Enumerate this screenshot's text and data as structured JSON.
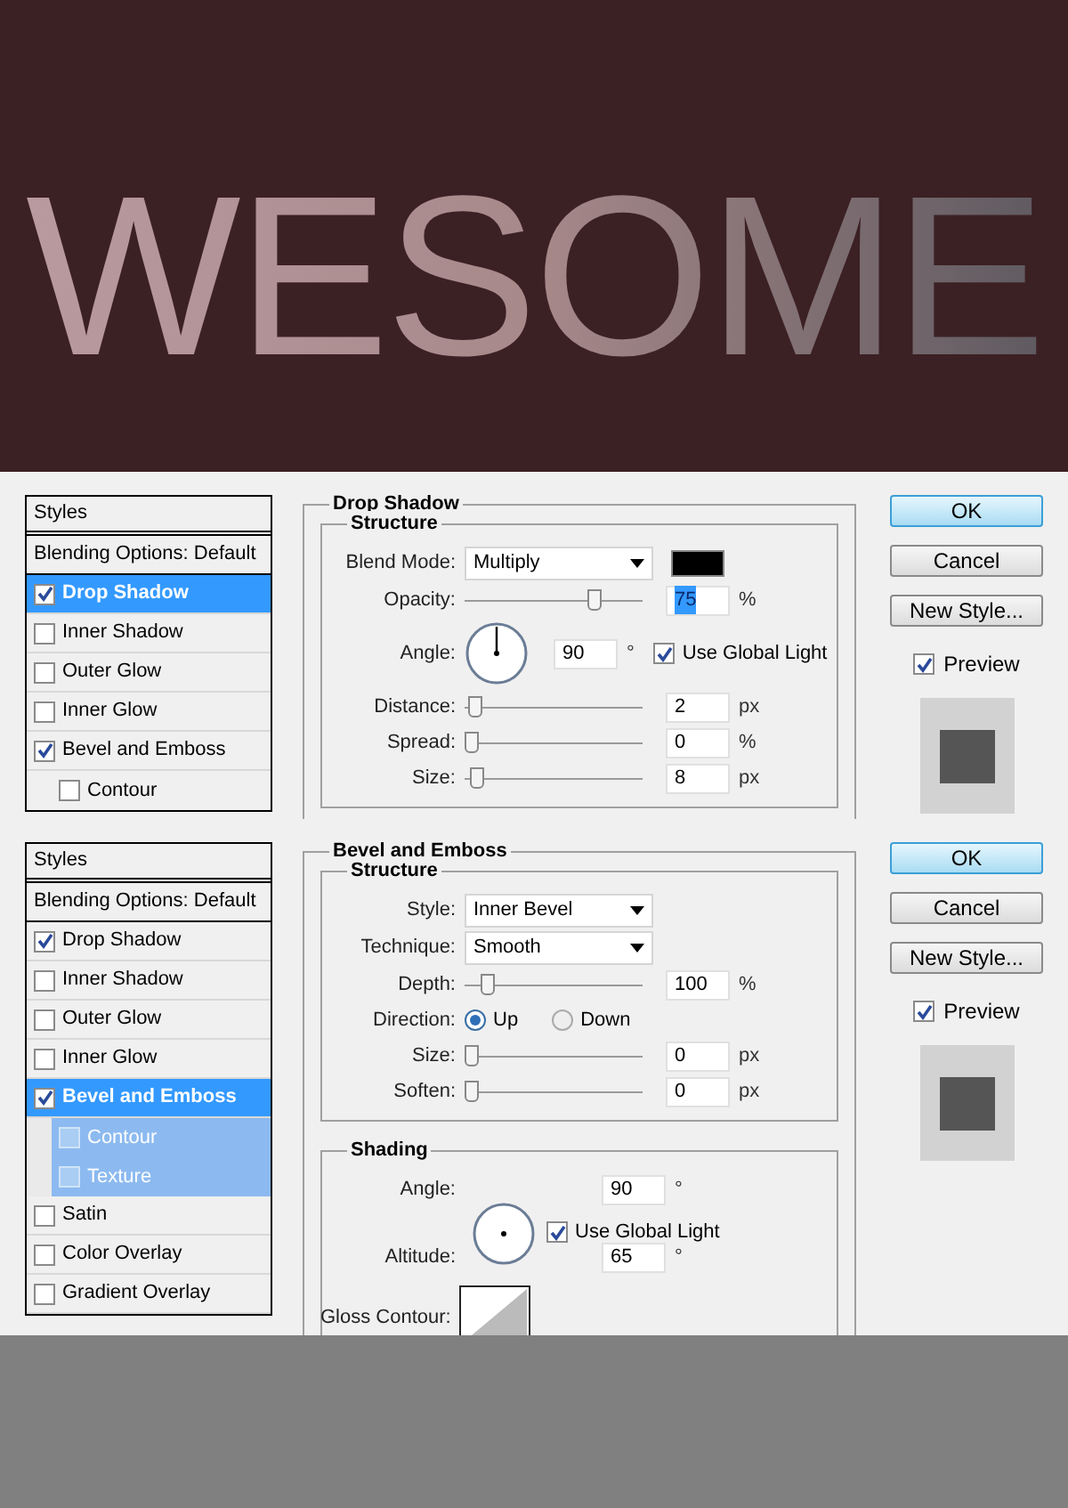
{
  "artwork": {
    "text": "WESOME"
  },
  "dialogs": [
    {
      "styles_header": "Styles",
      "styles": [
        {
          "label": "Blending Options: Default",
          "kind": "header",
          "selected": false
        },
        {
          "label": "Drop Shadow",
          "kind": "effect",
          "checked": true,
          "selected": true
        },
        {
          "label": "Inner Shadow",
          "kind": "effect",
          "checked": false,
          "selected": false
        },
        {
          "label": "Outer Glow",
          "kind": "effect",
          "checked": false,
          "selected": false
        },
        {
          "label": "Inner Glow",
          "kind": "effect",
          "checked": false,
          "selected": false
        },
        {
          "label": "Bevel and Emboss",
          "kind": "effect",
          "checked": true,
          "selected": false
        },
        {
          "label": "Contour",
          "kind": "sub",
          "checked": false,
          "selected": false
        }
      ],
      "section": {
        "title": "Drop Shadow",
        "groups": [
          {
            "title": "Structure",
            "rows": [
              {
                "kind": "select",
                "label": "Blend Mode:",
                "value": "Multiply",
                "swatch": true
              },
              {
                "kind": "slider",
                "label": "Opacity:",
                "level": 0.75,
                "value": "75",
                "unit": "%",
                "highlighted": true
              },
              {
                "kind": "angle",
                "label": "Angle:",
                "value": "90",
                "unit": "°",
                "global_light": {
                  "label": "Use Global Light",
                  "checked": true
                }
              },
              {
                "kind": "slider",
                "label": "Distance:",
                "level": 0.02,
                "value": "2",
                "unit": "px",
                "highlighted": false
              },
              {
                "kind": "slider",
                "label": "Spread:",
                "level": 0,
                "value": "0",
                "unit": "%",
                "highlighted": false
              },
              {
                "kind": "slider",
                "label": "Size:",
                "level": 0.03,
                "value": "8",
                "unit": "px",
                "highlighted": false
              }
            ]
          }
        ]
      },
      "buttons": [
        {
          "label": "OK",
          "default": true
        },
        {
          "label": "Cancel",
          "default": false
        },
        {
          "label": "New Style...",
          "default": false
        }
      ],
      "preview": {
        "label": "Preview",
        "checked": true
      }
    },
    {
      "styles_header": "Styles",
      "styles": [
        {
          "label": "Blending Options: Default",
          "kind": "header",
          "selected": false
        },
        {
          "label": "Drop Shadow",
          "kind": "effect",
          "checked": true,
          "selected": false
        },
        {
          "label": "Inner Shadow",
          "kind": "effect",
          "checked": false,
          "selected": false
        },
        {
          "label": "Outer Glow",
          "kind": "effect",
          "checked": false,
          "selected": false
        },
        {
          "label": "Inner Glow",
          "kind": "effect",
          "checked": false,
          "selected": false
        },
        {
          "label": "Bevel and Emboss",
          "kind": "effect",
          "checked": true,
          "selected": true
        },
        {
          "label": "Contour",
          "kind": "sub",
          "checked": false,
          "selected": true
        },
        {
          "label": "Texture",
          "kind": "sub",
          "checked": false,
          "selected": true
        },
        {
          "label": "Satin",
          "kind": "effect",
          "checked": false,
          "selected": false
        },
        {
          "label": "Color Overlay",
          "kind": "effect",
          "checked": false,
          "selected": false
        },
        {
          "label": "Gradient Overlay",
          "kind": "effect",
          "checked": false,
          "selected": false
        }
      ],
      "section": {
        "title": "Bevel and Emboss",
        "groups": [
          {
            "title": "Structure",
            "rows": [
              {
                "kind": "select",
                "label": "Style:",
                "value": "Inner Bevel"
              },
              {
                "kind": "select",
                "label": "Technique:",
                "value": "Smooth"
              },
              {
                "kind": "slider",
                "label": "Depth:",
                "level": 0.1,
                "value": "100",
                "unit": "%",
                "highlighted": false
              },
              {
                "kind": "radio",
                "label": "Direction:",
                "options": [
                  {
                    "label": "Up",
                    "selected": true
                  },
                  {
                    "label": "Down",
                    "selected": false
                  }
                ]
              },
              {
                "kind": "slider",
                "label": "Size:",
                "level": 0,
                "value": "0",
                "unit": "px",
                "highlighted": false
              },
              {
                "kind": "slider",
                "label": "Soften:",
                "level": 0,
                "value": "0",
                "unit": "px",
                "highlighted": false
              }
            ]
          },
          {
            "title": "Shading",
            "rows": [
              {
                "kind": "shading_angle",
                "label": "Angle:",
                "value": "90",
                "unit": "°",
                "global_light": {
                  "label": "Use Global Light",
                  "checked": true
                }
              },
              {
                "kind": "field",
                "label": "Altitude:",
                "value": "65",
                "unit": "°"
              },
              {
                "kind": "contour",
                "label": "Gloss Contour:"
              }
            ]
          }
        ]
      },
      "buttons": [
        {
          "label": "OK",
          "default": true
        },
        {
          "label": "Cancel",
          "default": false
        },
        {
          "label": "New Style...",
          "default": false
        }
      ],
      "preview": {
        "label": "Preview",
        "checked": true
      }
    }
  ]
}
